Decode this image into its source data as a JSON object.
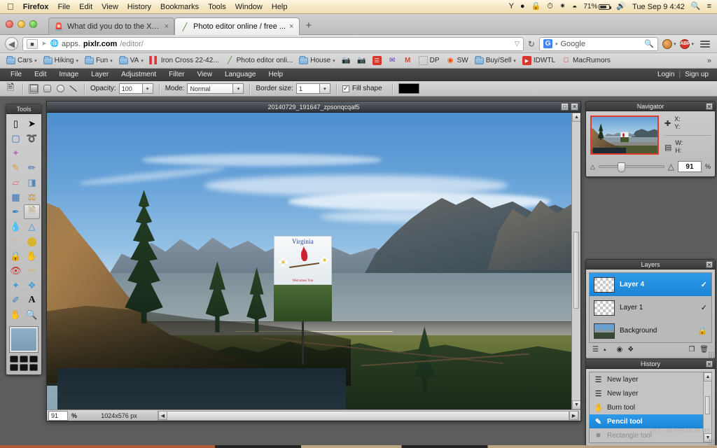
{
  "macbar": {
    "apple_icon": "apple-icon",
    "app_name": "Firefox",
    "menus": [
      "File",
      "Edit",
      "View",
      "History",
      "Bookmarks",
      "Tools",
      "Window",
      "Help"
    ],
    "status_icons": [
      "wine-glass-icon",
      "antivirus-shield-icon",
      "lock-icon",
      "time-machine-icon",
      "bluetooth-icon",
      "wifi-icon"
    ],
    "battery_percent": "71%",
    "volume_icon": "volume-icon",
    "clock": "Tue Sep 9  4:42",
    "search_icon": "spotlight-search-icon",
    "list_icon": "notification-center-icon"
  },
  "browser": {
    "tabs": [
      {
        "title": "What did you do to the X t...",
        "favicon": "forum-icon",
        "close": "×",
        "active": false
      },
      {
        "title": "Photo editor online / free ...",
        "favicon": "pixlr-pencil-icon",
        "close": "×",
        "active": true
      }
    ],
    "newtab_label": "+",
    "back_icon": "back-arrow-icon",
    "site_identity_icon": "site-identity-icon",
    "globe_icon": "globe-icon",
    "url_prefix": "apps.",
    "url_domain": "pixlr.com",
    "url_path": "/editor/",
    "url_dropdown": "▽",
    "reload_icon": "reload-icon",
    "search_engine": "Google",
    "search_engine_badge": "G",
    "search_dropdown": "▾",
    "search_icon": "search-magnifier-icon",
    "monkey_icon": "greasemonkey-icon",
    "adblock_icon": "adblock-plus-icon",
    "adblock_label": "ABP",
    "menu_icon": "hamburger-menu-icon"
  },
  "bookmarks": {
    "items": [
      {
        "label": "Cars",
        "icon": "folder-icon",
        "dropdown": true
      },
      {
        "label": "Hiking",
        "icon": "folder-icon",
        "dropdown": true
      },
      {
        "label": "Fun",
        "icon": "folder-icon",
        "dropdown": true
      },
      {
        "label": "VA",
        "icon": "folder-icon",
        "dropdown": true
      },
      {
        "label": "Iron Cross 22-42...",
        "icon": "red-bars-icon",
        "dropdown": false
      },
      {
        "label": "Photo editor onli...",
        "icon": "pixlr-pencil-icon",
        "dropdown": false
      },
      {
        "label": "House",
        "icon": "folder-icon",
        "dropdown": true
      },
      {
        "label": "",
        "icon": "camera-icon",
        "dropdown": false
      },
      {
        "label": "",
        "icon": "camera-icon",
        "dropdown": false
      },
      {
        "label": "",
        "icon": "red-card-icon",
        "dropdown": false
      },
      {
        "label": "",
        "icon": "mail-icon",
        "dropdown": false
      },
      {
        "label": "",
        "icon": "gmail-icon",
        "dropdown": false
      },
      {
        "label": "DP",
        "icon": "blank-page-icon",
        "dropdown": false
      },
      {
        "label": "SW",
        "icon": "reddit-icon",
        "dropdown": false
      },
      {
        "label": "Buy/Sell",
        "icon": "folder-icon",
        "dropdown": true
      },
      {
        "label": "IDWTL",
        "icon": "youtube-icon",
        "dropdown": false
      },
      {
        "label": "MacRumors",
        "icon": "macrumors-icon",
        "dropdown": false
      }
    ],
    "overflow": "»"
  },
  "pixlr": {
    "menu": [
      "File",
      "Edit",
      "Image",
      "Layer",
      "Adjustment",
      "Filter",
      "View",
      "Language",
      "Help"
    ],
    "login_label": "Login",
    "separator": "|",
    "signup_label": "Sign up",
    "version_info": "v.6.7 - 60 FPS 50.75 MB"
  },
  "options_bar": {
    "active_tool_icon": "shape-tool-icon",
    "shapes": [
      {
        "name": "rectangle-shape",
        "selected": false
      },
      {
        "name": "rounded-rectangle-shape",
        "selected": false
      },
      {
        "name": "ellipse-shape",
        "selected": false
      },
      {
        "name": "line-shape",
        "selected": false
      }
    ],
    "opacity_label": "Opacity:",
    "opacity_value": "100",
    "mode_label": "Mode:",
    "mode_value": "Normal",
    "border_label": "Border size:",
    "border_value": "1",
    "fill_shape_label": "Fill shape",
    "fill_shape_checked": "✓",
    "color_swatch": "#000000",
    "dropdown_glyph": "▾"
  },
  "tools_panel": {
    "title": "Tools",
    "items": [
      {
        "name": "crop-tool",
        "glyph": "⛶",
        "active": false
      },
      {
        "name": "move-tool",
        "glyph": "➤",
        "active": false
      },
      {
        "name": "marquee-select-tool",
        "glyph": "⬚",
        "active": false
      },
      {
        "name": "lasso-tool",
        "glyph": "➰",
        "active": false
      },
      {
        "name": "magic-wand-tool",
        "glyph": "✦",
        "active": false
      },
      {
        "name": "pencil-tool",
        "glyph": "✎",
        "active": false
      },
      {
        "name": "brush-tool",
        "glyph": "🖌",
        "active": false
      },
      {
        "name": "eraser-tool",
        "glyph": "▱",
        "active": false
      },
      {
        "name": "paint-bucket-tool",
        "glyph": "◢",
        "active": false
      },
      {
        "name": "gradient-tool",
        "glyph": "▤",
        "active": false
      },
      {
        "name": "clone-stamp-tool",
        "glyph": "⚓",
        "active": false
      },
      {
        "name": "drawing-tool",
        "glyph": "✒",
        "active": false
      },
      {
        "name": "shape-tool",
        "glyph": "⬟",
        "active": true
      },
      {
        "name": "blur-tool",
        "glyph": "💧",
        "active": false
      },
      {
        "name": "sharpen-tool",
        "glyph": "△",
        "active": false
      },
      {
        "name": "smudge-tool",
        "glyph": "☛",
        "active": false
      },
      {
        "name": "sponge-tool",
        "glyph": "⬤",
        "active": false
      },
      {
        "name": "dodge-tool",
        "glyph": "⚫",
        "active": false
      },
      {
        "name": "burn-tool",
        "glyph": "✋",
        "active": false
      },
      {
        "name": "red-eye-tool",
        "glyph": "👁",
        "active": false
      },
      {
        "name": "spot-heal-tool",
        "glyph": "✂",
        "active": false
      },
      {
        "name": "bloat-tool",
        "glyph": "⬦",
        "active": false
      },
      {
        "name": "pinch-tool",
        "glyph": "❖",
        "active": false
      },
      {
        "name": "color-picker-tool",
        "glyph": "✐",
        "active": false
      },
      {
        "name": "type-tool",
        "glyph": "A",
        "active": false
      },
      {
        "name": "hand-tool",
        "glyph": "✋",
        "active": false
      },
      {
        "name": "zoom-tool",
        "glyph": "⌕",
        "active": false
      }
    ],
    "foreground_color": "#86a8be",
    "palette_swatch_color": "#101010",
    "palette_count": 6
  },
  "canvas_window": {
    "title": "20140729_191647_zpsonqcqaf5",
    "maximize_glyph": "□",
    "close_glyph": "✕",
    "zoom_value": "91",
    "zoom_unit": "%",
    "dimensions": "1024x576 px",
    "scroll_left_glyph": "◀",
    "scroll_up_glyph": "▲",
    "scroll_down_glyph": "▼",
    "scroll_right_glyph": "▶",
    "image": {
      "sign_title": "Virginia",
      "sign_subtitle": "Welcomes You"
    }
  },
  "navigator": {
    "title": "Navigator",
    "close_glyph": "✕",
    "x_label": "X:",
    "y_label": "Y:",
    "w_label": "W:",
    "h_label": "H:",
    "position_icon": "crosshair-icon",
    "size_icon": "bounding-box-icon",
    "zoom_out_icon": "zoom-out-small-icon",
    "zoom_in_icon": "zoom-in-large-icon",
    "zoom_value": "91",
    "zoom_unit": "%"
  },
  "layers": {
    "title": "Layers",
    "close_glyph": "✕",
    "items": [
      {
        "name": "Layer 4",
        "selected": true,
        "visible_glyph": "✓",
        "thumb": "transparent",
        "locked": false
      },
      {
        "name": "Layer 1",
        "selected": false,
        "visible_glyph": "✓",
        "thumb": "transparent",
        "locked": false
      },
      {
        "name": "Background",
        "selected": false,
        "visible_glyph": "🔒",
        "thumb": "photo",
        "locked": true
      }
    ],
    "toolbar": [
      {
        "name": "layer-settings-button",
        "glyph": "☰"
      },
      {
        "name": "layer-settings-arrow",
        "glyph": "▴"
      },
      {
        "name": "layer-mask-button",
        "glyph": "◉"
      },
      {
        "name": "layer-style-button",
        "glyph": "❖"
      },
      {
        "name": "new-layer-button",
        "glyph": "❐"
      },
      {
        "name": "delete-layer-button",
        "glyph": "🗑"
      }
    ]
  },
  "history": {
    "title": "History",
    "close_glyph": "✕",
    "items": [
      {
        "label": "New layer",
        "icon": "new-layer-icon",
        "state": "normal"
      },
      {
        "label": "New layer",
        "icon": "new-layer-icon",
        "state": "normal"
      },
      {
        "label": "Burn tool",
        "icon": "burn-tool-icon",
        "state": "normal"
      },
      {
        "label": "Pencil tool",
        "icon": "pencil-tool-icon",
        "state": "selected"
      },
      {
        "label": "Rectangle tool",
        "icon": "rectangle-tool-icon",
        "state": "dimmed"
      }
    ],
    "scroll_up_glyph": "▲",
    "scroll_down_glyph": "▼"
  }
}
